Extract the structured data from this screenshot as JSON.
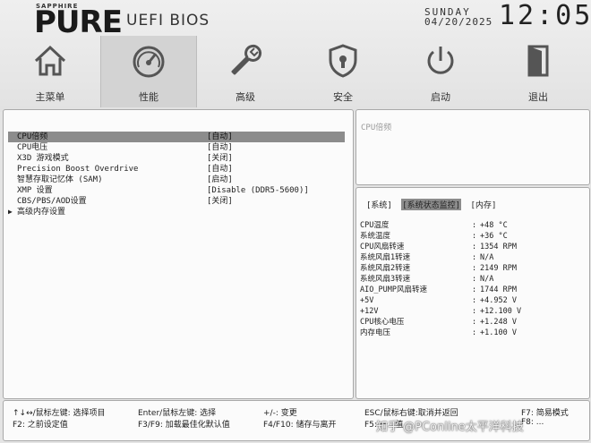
{
  "brand": {
    "small": "SAPPHIRE",
    "logo": "PURE",
    "subtitle": "UEFI BIOS"
  },
  "clock": {
    "day": "SUNDAY",
    "date": "04/20/2025",
    "time": "12:05"
  },
  "nav": [
    {
      "label": "主菜单",
      "icon": "home-icon"
    },
    {
      "label": "性能",
      "icon": "speedometer-icon",
      "active": true
    },
    {
      "label": "高级",
      "icon": "wrench-icon"
    },
    {
      "label": "安全",
      "icon": "shield-lock-icon"
    },
    {
      "label": "启动",
      "icon": "power-icon"
    },
    {
      "label": "退出",
      "icon": "exit-door-icon"
    }
  ],
  "menu": [
    {
      "label": "CPU倍频",
      "value": "[自动]",
      "selected": true
    },
    {
      "label": "CPU电压",
      "value": "[自动]"
    },
    {
      "label": "X3D 游戏模式",
      "value": "[关闭]"
    },
    {
      "label": "Precision Boost Overdrive",
      "value": "[自动]"
    },
    {
      "label": "智慧存取记忆体 (SAM)",
      "value": "[启动]"
    },
    {
      "label": "XMP 设置",
      "value": "[Disable (DDR5-5600)]"
    },
    {
      "label": "CBS/PBS/AOD设置",
      "value": "[关闭]"
    },
    {
      "label": "高级内存设置",
      "value": "",
      "submenu": true,
      "arrow": "▶"
    }
  ],
  "help": {
    "text": "CPU倍频"
  },
  "hw_tabs": [
    {
      "label": "[系统]"
    },
    {
      "label": "[系统状态监控]",
      "active": true
    },
    {
      "label": "[内存]"
    }
  ],
  "hw_monitor": [
    {
      "label": "CPU温度",
      "value": "+48 °C"
    },
    {
      "label": "系统温度",
      "value": "+36 °C"
    },
    {
      "label": "CPU风扇转速",
      "value": "1354 RPM"
    },
    {
      "label": "系统风扇1转速",
      "value": "N/A"
    },
    {
      "label": "系统风扇2转速",
      "value": "2149 RPM"
    },
    {
      "label": "系统风扇3转速",
      "value": "N/A"
    },
    {
      "label": "AIO_PUMP风扇转速",
      "value": "1744 RPM"
    },
    {
      "label": "+5V",
      "value": "+4.952 V"
    },
    {
      "label": "+12V",
      "value": "+12.100 V"
    },
    {
      "label": "CPU核心电压",
      "value": "+1.248 V"
    },
    {
      "label": "内存电压",
      "value": "+1.100 V"
    }
  ],
  "footer": {
    "select_item": "↑↓↔/鼠标左键: 选择项目",
    "prev_default": "F2: 之前设定值",
    "enter_select": "Enter/鼠标左键: 选择",
    "optimized": "F3/F9: 加载最佳化默认值",
    "change": "+/-: 变更",
    "save_exit": "F4/F10: 储存与离开",
    "esc": "ESC/鼠标右键:取消并返回",
    "f5": "F5: 一...值",
    "easy_mode": "F7: 简易模式",
    "f8": "F8: ...",
    "watermark": "知乎 @PConline太平洋科技"
  }
}
